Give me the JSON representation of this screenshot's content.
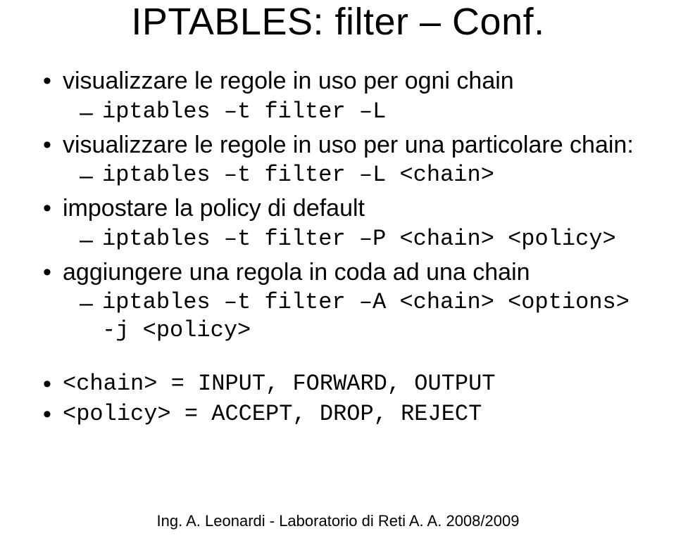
{
  "title": "IPTABLES: filter – Conf.",
  "bullets": [
    {
      "text": "visualizzare le regole in uso per ogni chain",
      "sub": [
        "iptables –t filter –L"
      ]
    },
    {
      "text": "visualizzare le regole in uso per una particolare chain:",
      "sub": [
        "iptables –t filter –L <chain>"
      ]
    },
    {
      "text": "impostare la policy di default",
      "sub": [
        "iptables –t filter –P <chain> <policy>"
      ]
    },
    {
      "text": "aggiungere una regola in coda ad una chain",
      "sub": [
        "iptables –t filter –A <chain> <options> -j <policy>"
      ]
    }
  ],
  "bottom": [
    "<chain> = INPUT, FORWARD, OUTPUT",
    "<policy> = ACCEPT, DROP, REJECT"
  ],
  "footer": "Ing. A. Leonardi - Laboratorio di Reti A. A. 2008/2009"
}
